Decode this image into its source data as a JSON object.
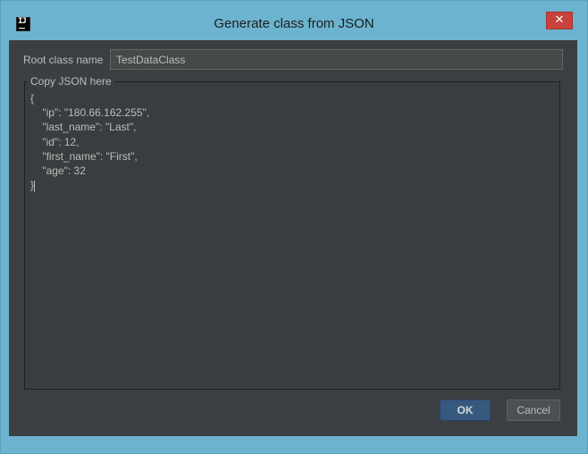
{
  "window": {
    "title": "Generate class from JSON",
    "app_icon_glyph": "IJ",
    "close_glyph": "✕"
  },
  "form": {
    "root_class_label": "Root class name",
    "root_class_value": "TestDataClass",
    "json_group_label": "Copy JSON here",
    "json_text": "{\n    \"ip\": \"180.66.162.255\",\n    \"last_name\": \"Last\",\n    \"id\": 12,\n    \"first_name\": \"First\",\n    \"age\": 32\n}"
  },
  "buttons": {
    "ok_label": "OK",
    "cancel_label": "Cancel"
  },
  "colors": {
    "title_bar": "#6cb3cf",
    "close_button": "#c7423d",
    "panel_background": "#3c3f41",
    "ok_button": "#375980"
  }
}
